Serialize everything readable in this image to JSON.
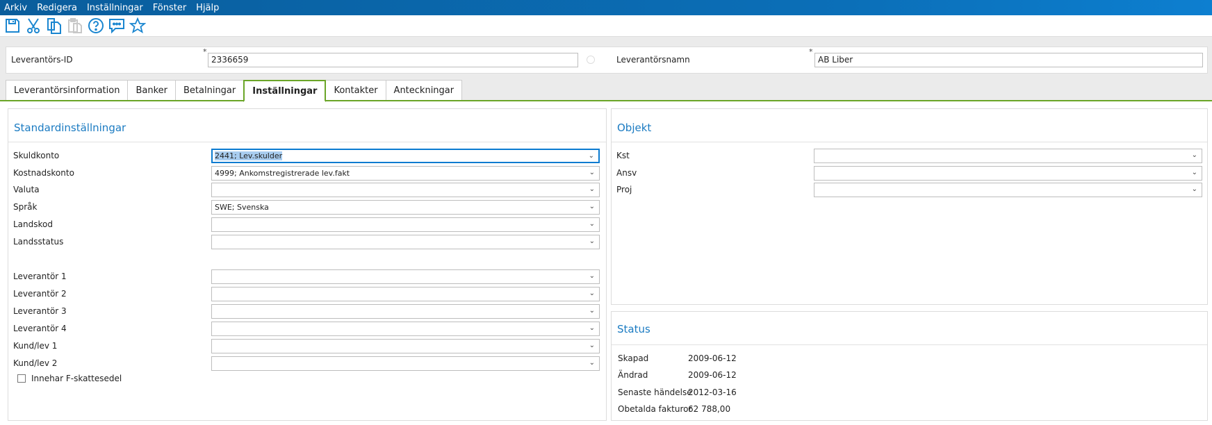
{
  "menu": [
    "Arkiv",
    "Redigera",
    "Inställningar",
    "Fönster",
    "Hjälp"
  ],
  "toolbar": {
    "icons": [
      "save-icon",
      "cut-icon",
      "copy-icon",
      "paste-icon",
      "help-icon",
      "chat-icon",
      "favorite-icon"
    ]
  },
  "header": {
    "id_label": "Leverantörs-ID",
    "id_value": "2336659",
    "name_label": "Leverantörsnamn",
    "name_value": "AB Liber",
    "required_mark": "*"
  },
  "tabs": [
    "Leverantörsinformation",
    "Banker",
    "Betalningar",
    "Inställningar",
    "Kontakter",
    "Anteckningar"
  ],
  "active_tab": "Inställningar",
  "standard": {
    "title": "Standardinställningar",
    "fields": [
      {
        "label": "Skuldkonto",
        "value": "2441; Lev.skulder"
      },
      {
        "label": "Kostnadskonto",
        "value": "4999; Ankomstregistrerade lev.fakt"
      },
      {
        "label": "Valuta",
        "value": ""
      },
      {
        "label": "Språk",
        "value": "SWE; Svenska"
      },
      {
        "label": "Landskod",
        "value": ""
      },
      {
        "label": "Landsstatus",
        "value": ""
      }
    ],
    "fields2": [
      {
        "label": "Leverantör 1",
        "value": ""
      },
      {
        "label": "Leverantör 2",
        "value": ""
      },
      {
        "label": "Leverantör 3",
        "value": ""
      },
      {
        "label": "Leverantör 4",
        "value": ""
      },
      {
        "label": "Kund/lev 1",
        "value": ""
      },
      {
        "label": "Kund/lev 2",
        "value": ""
      }
    ],
    "checkbox_label": "Innehar F-skattesedel",
    "checkbox_checked": false
  },
  "objekt": {
    "title": "Objekt",
    "fields": [
      {
        "label": "Kst",
        "value": ""
      },
      {
        "label": "Ansv",
        "value": ""
      },
      {
        "label": "Proj",
        "value": ""
      }
    ]
  },
  "status": {
    "title": "Status",
    "rows": [
      {
        "label": "Skapad",
        "value": "2009-06-12"
      },
      {
        "label": "Ändrad",
        "value": "2009-06-12"
      },
      {
        "label": "Senaste händelse",
        "value": "2012-03-16"
      },
      {
        "label": "Obetalda fakturor",
        "value": "62 788,00"
      }
    ]
  },
  "colors": {
    "accent": "#1b7bc2",
    "tab_active": "#6aa527",
    "menubar": "#0b6fb8"
  }
}
